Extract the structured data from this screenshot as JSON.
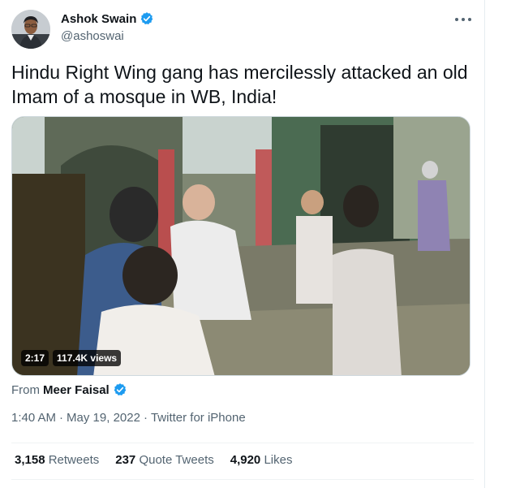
{
  "author": {
    "display_name": "Ashok Swain",
    "handle": "@ashoswai",
    "verified_color": "#1d9bf0"
  },
  "tweet": {
    "text": "Hindu Right Wing gang has mercilessly attacked an old Imam of a mosque in WB, India!"
  },
  "video": {
    "duration": "2:17",
    "views": "117.4K views"
  },
  "attribution": {
    "from_label": "From",
    "from_name": "Meer Faisal"
  },
  "meta": {
    "time": "1:40 AM",
    "separator": "·",
    "date": "May 19, 2022",
    "source": "Twitter for iPhone"
  },
  "stats": [
    {
      "count": "3,158",
      "label": "Retweets"
    },
    {
      "count": "237",
      "label": "Quote Tweets"
    },
    {
      "count": "4,920",
      "label": "Likes"
    }
  ],
  "icons": {
    "more": "more-horizontal-icon",
    "verified": "verified-badge-icon"
  },
  "colors": {
    "text_primary": "#0f1419",
    "text_secondary": "#536471",
    "divider": "#eff3f4"
  }
}
